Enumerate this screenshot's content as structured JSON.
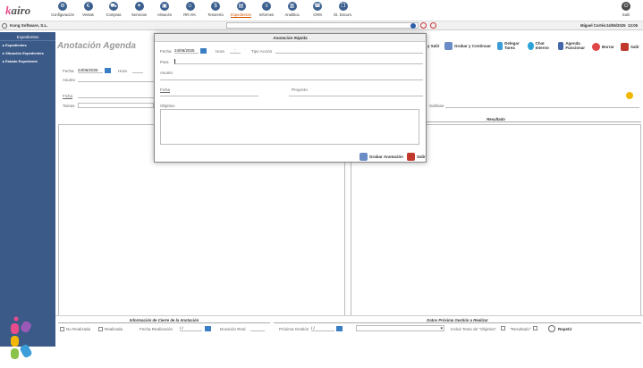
{
  "app": {
    "logo_k": "k",
    "logo_rest": "airo"
  },
  "nav": [
    {
      "label": "Configuración",
      "icon": "gear-icon",
      "g": "⚙"
    },
    {
      "label": "Ventas",
      "icon": "sales-icon",
      "g": "€"
    },
    {
      "label": "Compras",
      "icon": "cart-icon",
      "g": "⛟"
    },
    {
      "label": "Servicios",
      "icon": "services-icon",
      "g": "✦"
    },
    {
      "label": "Almacén",
      "icon": "warehouse-icon",
      "g": "▣"
    },
    {
      "label": "RR.HH.",
      "icon": "people-icon",
      "g": "☺"
    },
    {
      "label": "Tesorería",
      "icon": "treasury-icon",
      "g": "$"
    },
    {
      "label": "Expedientes",
      "icon": "folder-icon",
      "g": "▤"
    },
    {
      "label": "Informes",
      "icon": "reports-icon",
      "g": "≡"
    },
    {
      "label": "Analítica",
      "icon": "analytics-icon",
      "g": "▥"
    },
    {
      "label": "CRM",
      "icon": "crm-icon",
      "g": "☎"
    },
    {
      "label": "Gt. Docum.",
      "icon": "documents-icon",
      "g": "❐"
    }
  ],
  "salir_top": "Salir",
  "company": "Kong Software, S.L.",
  "user": "Miguel Cortés",
  "date_top": "24/06/2025",
  "time_top": "13:05",
  "sidebar": {
    "header": "Expedientes",
    "items": [
      "Expedientes",
      "Situación Expedientes",
      "Estado Expediente"
    ]
  },
  "page": {
    "title": "Anotación Agenda",
    "fecha_label": "Fecha",
    "fecha": "24/06/2025",
    "hora_label": "Hora",
    "asunto_label": "Asunto",
    "ficha_label": "Ficha",
    "tareas_label": "Tareas",
    "subfase_label": "Subfase"
  },
  "toolbar": {
    "salir2": "y Salir",
    "grabar_continuar": "Grabar y Continuar",
    "delegar": "Delegar Tarea",
    "chat": "Chat Interno",
    "agenda": "Agenda Funcionar",
    "borrar": "Borrar",
    "salir": "Salir"
  },
  "resultado_header": "Resultado",
  "bottom_left": {
    "header": "Información de Cierre de la Anotación",
    "no_realizada": "No Realizada",
    "realizada": "Realizada",
    "fecha_real": "Fecha Realización",
    "fecha_val": "/ /",
    "duracion": "Duración Real"
  },
  "bottom_right": {
    "header": "Datos Próxima Gestión a Realizar",
    "proxima": "Próxima Gestión",
    "proxima_val": "/ /",
    "incluir": "Incluir Texto de \"Objetivo\"",
    "resultado": "\"Resultado\"",
    "repetir": "Repetir"
  },
  "modal": {
    "title": "Anotación Rápida",
    "fecha_label": "Fecha",
    "fecha": "24/06/2025",
    "hora_label": "Hora",
    "hora": ":",
    "tipo_label": "Tipo Acción",
    "para_label": "Para",
    "asunto_label": "Asunto",
    "ficha_label": "Ficha",
    "proyecto_label": "Proyecto",
    "objetivo_label": "Objetivo",
    "grabar": "Grabar Anotación",
    "salir": "Salir"
  }
}
